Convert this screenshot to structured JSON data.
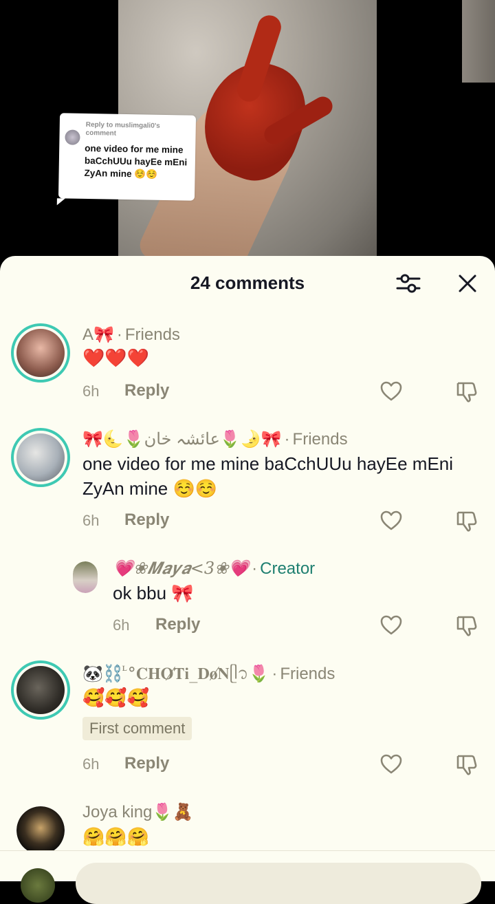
{
  "video": {
    "reply_card": {
      "header": "Reply to muslimgali0's comment",
      "text": "one video for me mine baCchUUu hayEe mEni ZyAn mine ☺️☺️"
    }
  },
  "sheet": {
    "title": "24 comments",
    "filter_icon": "sliders-icon",
    "close_icon": "close-icon"
  },
  "comments": [
    {
      "name": "A🎀",
      "tag": "Friends",
      "text": "❤️❤️❤️",
      "time": "6h",
      "reply_label": "Reply"
    },
    {
      "name": "🎀🌜🌷عائشہ خان🌷🌛🎀",
      "tag": "Friends",
      "text": "one video for me mine baCchUUu hayEe mEni ZyAn mine ☺️☺️",
      "time": "6h",
      "reply_label": "Reply",
      "reply": {
        "name": "💗❀𝑴𝒂𝒚𝒂<3❀💗",
        "tag": "Creator",
        "text": "ok bbu 🎀",
        "time": "6h",
        "reply_label": "Reply"
      }
    },
    {
      "name": "🐼⛓️ ᷞ°𝐂𝐇𝐎̸𝐓𝐢_𝐃𝐨̸𝐍ᥫ᭡🌷",
      "tag": "Friends",
      "text": "🥰🥰🥰",
      "badge": "First comment",
      "time": "6h",
      "reply_label": "Reply"
    },
    {
      "name": "Joya king🌷🧸",
      "text": "🤗🤗🤗"
    }
  ],
  "colors": {
    "sheet_bg": "#fdfdf2",
    "ring": "#3ec9b3",
    "creator": "#1e7f70",
    "muted": "#8a8675"
  }
}
